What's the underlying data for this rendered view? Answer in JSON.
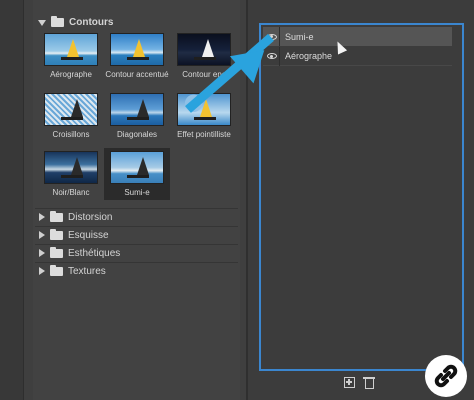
{
  "left_panel": {
    "expanded_folder": "Contours",
    "thumbnails": [
      {
        "label": "Aérographe",
        "style": "sky-a",
        "sail": "yellow"
      },
      {
        "label": "Contour accentué",
        "style": "sky-b",
        "sail": "yellow"
      },
      {
        "label": "Contour enc",
        "style": "sky-c",
        "sail": "light"
      },
      {
        "label": "Croisillons",
        "style": "sky-d",
        "sail": "dark"
      },
      {
        "label": "Diagonales",
        "style": "sky-e",
        "sail": "dark"
      },
      {
        "label": "Effet pointilliste",
        "style": "sky-f",
        "sail": "yellow"
      },
      {
        "label": "Noir/Blanc",
        "style": "sky-g",
        "sail": "dark"
      },
      {
        "label": "Sumi-e",
        "style": "sky-h",
        "sail": "dark"
      }
    ],
    "collapsed_folders": [
      "Distorsion",
      "Esquisse",
      "Esthétiques",
      "Textures"
    ]
  },
  "layers_panel": {
    "layers": [
      {
        "label": "Sumi-e",
        "active": true
      },
      {
        "label": "Aérographe",
        "active": false
      }
    ],
    "accent_color": "#3b86cf"
  },
  "annotation": {
    "arrow_color": "#2aa3de"
  }
}
